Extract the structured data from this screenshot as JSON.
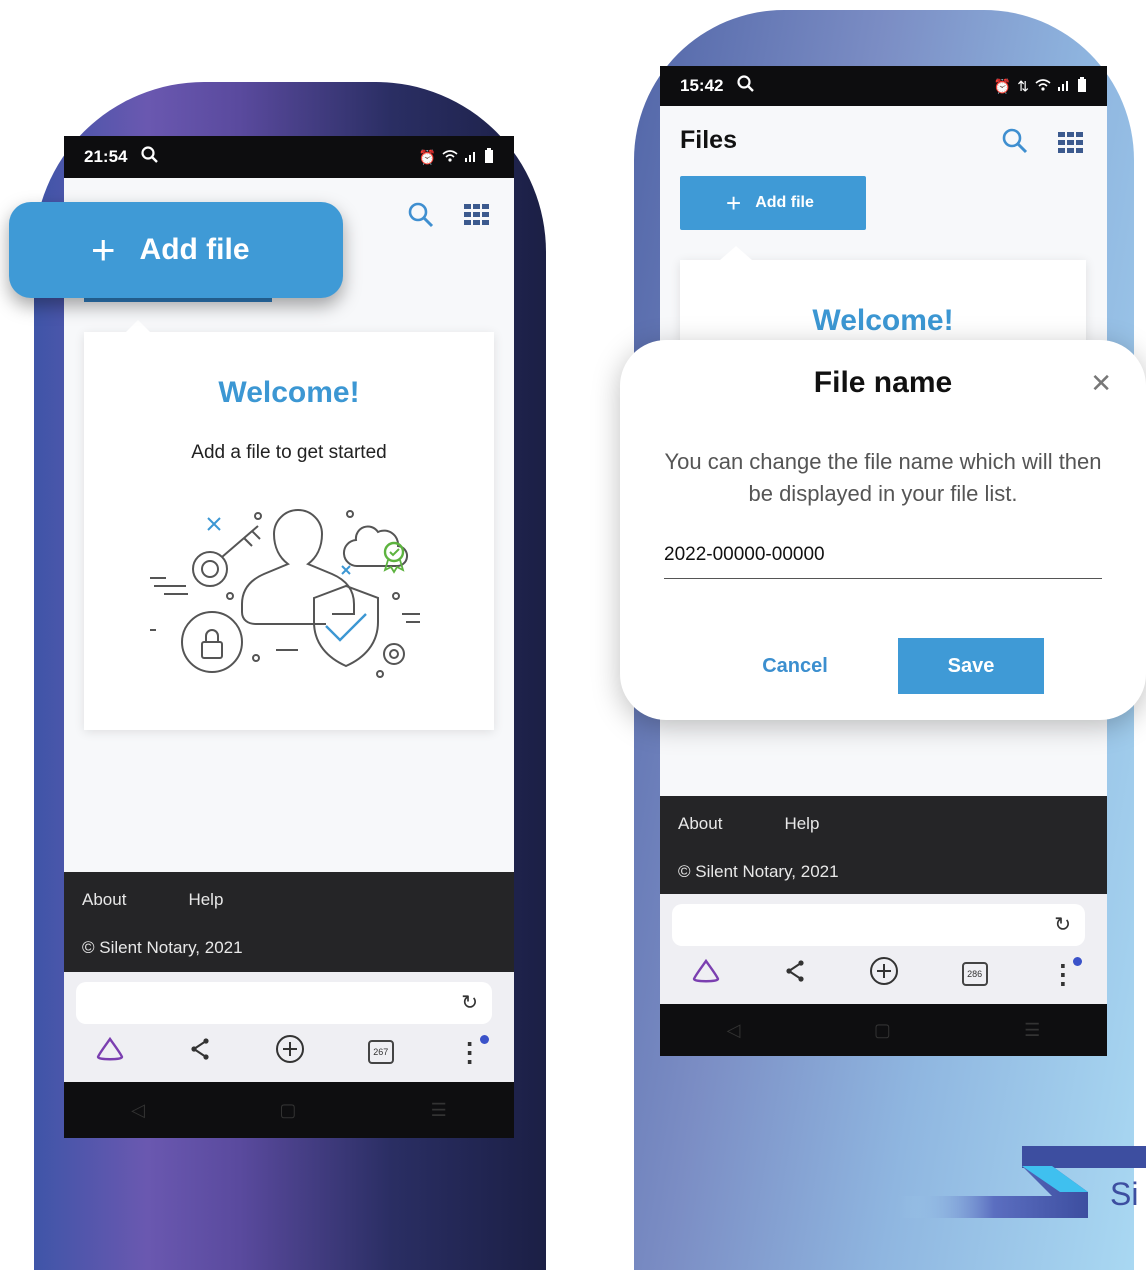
{
  "colors": {
    "accent": "#3f9ad6",
    "welcome": "#3c97d3",
    "footer": "#252527"
  },
  "left_phone": {
    "status": {
      "time": "21:54"
    },
    "add_file_label": "Add file",
    "welcome_title": "Welcome!",
    "welcome_subtitle": "Add a file to get started",
    "footer": {
      "about": "About",
      "help": "Help",
      "copyright": "© Silent Notary, 2021"
    },
    "browser": {
      "tab_count": "267"
    }
  },
  "right_phone": {
    "status": {
      "time": "15:42"
    },
    "page_title": "Files",
    "add_file_label": "Add file",
    "welcome_title": "Welcome!",
    "footer": {
      "about": "About",
      "help": "Help",
      "copyright": "© Silent Notary, 2021"
    },
    "browser": {
      "tab_count": "286"
    }
  },
  "dialog": {
    "title": "File name",
    "message": "You can change the file name which will then be displayed in your file list.",
    "input_value": "2022-00000-00000",
    "cancel_label": "Cancel",
    "save_label": "Save"
  },
  "brand_fragment": "Si"
}
